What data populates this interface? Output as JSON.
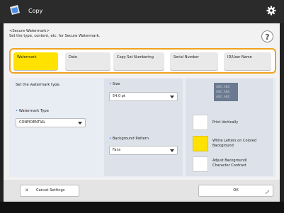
{
  "app": {
    "title": "Copy"
  },
  "header": {
    "line1": "<Secure Watermark>",
    "line2": "Set the type, content, etc. for Secure Watermark."
  },
  "tabs": [
    {
      "label": "Watermark",
      "selected": true
    },
    {
      "label": "Date",
      "selected": false
    },
    {
      "label": "Copy Set Numbering",
      "selected": false
    },
    {
      "label": "Serial Number",
      "selected": false
    },
    {
      "label": "ID/User Name",
      "selected": false
    }
  ],
  "left": {
    "instruction": "Set the watermark type.",
    "type_label": "Watermark Type",
    "type_value": "CONFIDENTIAL"
  },
  "middle": {
    "size_label": "Size",
    "size_value": "54.0 pt",
    "bg_label": "Background Pattern",
    "bg_value": "Fans"
  },
  "right": {
    "preview_text": "ABC ABC",
    "options": [
      {
        "label": "Print Vertically",
        "checked": false
      },
      {
        "label": "White Letters on Colored Background",
        "checked": true
      },
      {
        "label": "Adjust Background/ Character Contrast",
        "checked": false
      }
    ]
  },
  "footer": {
    "cancel_label": "Cancel Settings",
    "ok_label": "OK"
  },
  "colors": {
    "accent": "#ffe200",
    "tab_border": "#f0a21d",
    "bullet": "#2f6fd0"
  }
}
